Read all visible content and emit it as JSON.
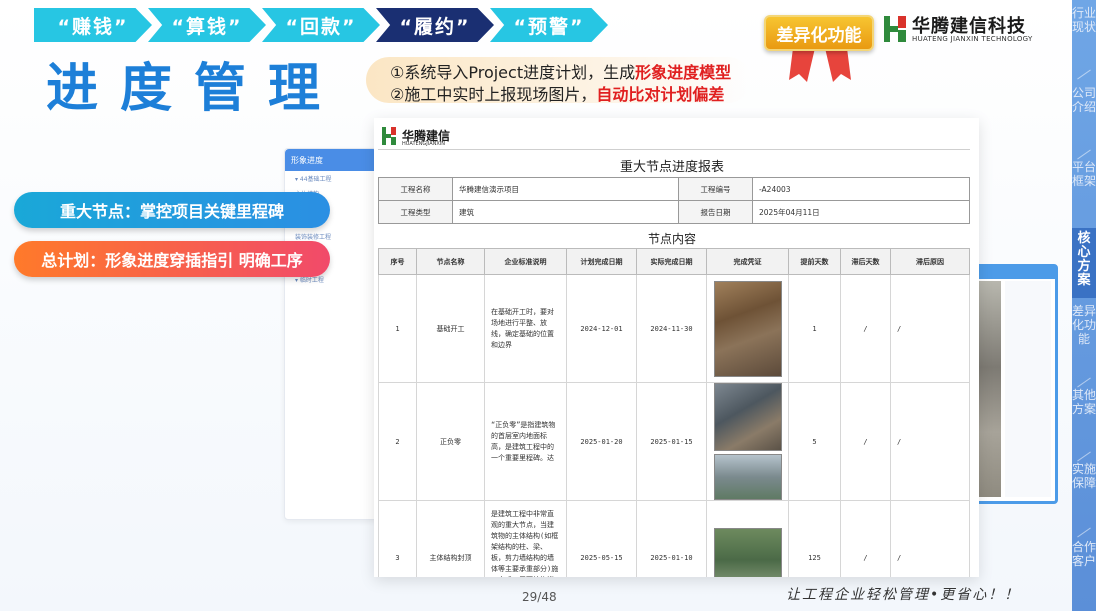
{
  "tabs": [
    {
      "label": "“赚钱”",
      "active": false
    },
    {
      "label": "“算钱”",
      "active": false
    },
    {
      "label": "“回款”",
      "active": false
    },
    {
      "label": "“履约”",
      "active": true
    },
    {
      "label": "“预警”",
      "active": false
    }
  ],
  "page_title": "进度管理",
  "description": {
    "line1_prefix": "①系统导入Project进度计划，生成",
    "line1_highlight": "形象进度模型",
    "line2_prefix": "②施工中实时上报现场图片，",
    "line2_highlight": "自动比对计划偏差"
  },
  "badge": {
    "label": "差异化功能"
  },
  "brand": {
    "name": "华腾建信科技",
    "sub": "HUATENG JIANXIN TECHNOLOGY"
  },
  "sidenav": [
    {
      "label": "行业现状",
      "active": false
    },
    {
      "label": "公司介绍",
      "active": false
    },
    {
      "label": "平台框架",
      "active": false
    },
    {
      "label": "核心方案",
      "active": true
    },
    {
      "label": "差异化功能",
      "active": false
    },
    {
      "label": "其他方案",
      "active": false
    },
    {
      "label": "实施保障",
      "active": false
    },
    {
      "label": "合作客户",
      "active": false
    }
  ],
  "pills": [
    {
      "label": "重大节点：掌控项目关键里程碑"
    },
    {
      "label": "总计划：形象进度穿插指引 明确工序"
    }
  ],
  "bg_panel": {
    "header": "形象进度",
    "items": [
      "▾ 44基础工程",
      "  主体结构",
      "  ...",
      "  二次结构",
      "  装饰装修工程",
      "  ...",
      "  工程",
      "▾ 临时工程"
    ]
  },
  "report": {
    "logo_name": "华腾建信",
    "logo_sub": "HUATENGJIANXIN",
    "title": "重大节点进度报表",
    "info": {
      "project_name_label": "工程名称",
      "project_name": "华腾建信演示项目",
      "project_no_label": "工程编号",
      "project_no": "-A24003",
      "project_type_label": "工程类型",
      "project_type": "建筑",
      "report_date_label": "报告日期",
      "report_date": "2025年04月11日"
    },
    "section_title": "节点内容",
    "columns": [
      "序号",
      "节点名称",
      "企业标准说明",
      "计划完成日期",
      "实际完成日期",
      "完成凭证",
      "提前天数",
      "滞后天数",
      "滞后原因"
    ],
    "rows": [
      {
        "no": "1",
        "name": "基础开工",
        "desc": "在基础开工时，要对场地进行平整、放线，确定基础的位置和边界",
        "plan": "2024-12-01",
        "actual": "2024-11-30",
        "ahead": "1",
        "delay": "/",
        "reason": "/"
      },
      {
        "no": "2",
        "name": "正负零",
        "desc": "“正负零”是指建筑物的首层室内地面标高，是建筑工程中的一个重要里程碑。达",
        "plan": "2025-01-20",
        "actual": "2025-01-15",
        "ahead": "5",
        "delay": "/",
        "reason": "/"
      },
      {
        "no": "3",
        "name": "主体结构封顶",
        "desc": "是建筑工程中非常直观的重大节点，当建筑物的主体结构(如框架结构的柱、梁、板，剪力墙结构的墙体等主要承重部分)施工完成，屋面结构浇筑完毕后，就达到了封顶状态",
        "plan": "2025-05-15",
        "actual": "2025-01-10",
        "ahead": "125",
        "delay": "/",
        "reason": "/"
      }
    ]
  },
  "footer": {
    "page": "29/48",
    "slogan": "让工程企业轻松管理•更省心！！"
  }
}
